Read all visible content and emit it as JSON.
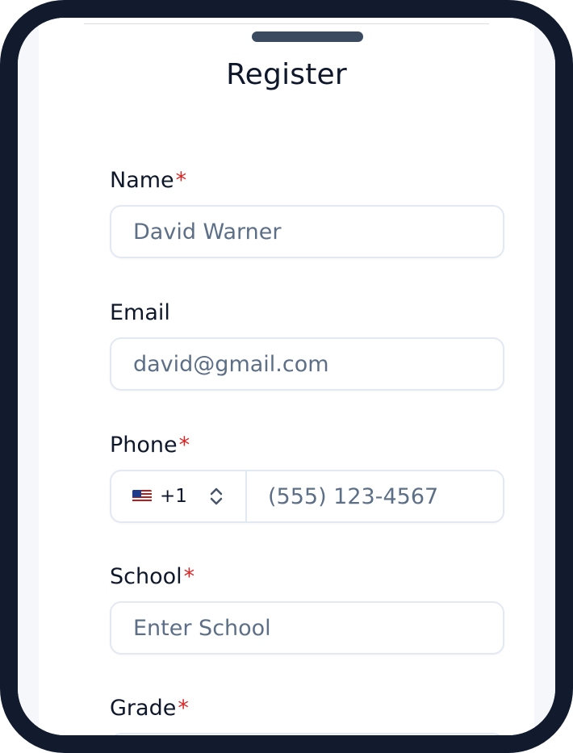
{
  "sheet": {
    "title": "Register"
  },
  "form": {
    "required_mark": "*",
    "name": {
      "label": "Name",
      "value": "David Warner"
    },
    "email": {
      "label": "Email",
      "value": "david@gmail.com"
    },
    "phone": {
      "label": "Phone",
      "country_code": "+1",
      "flag_icon": "us-flag-icon",
      "stepper_icon": "up-down-chevron-icon",
      "placeholder": "(555) 123-4567"
    },
    "school": {
      "label": "School",
      "placeholder": "Enter School"
    },
    "grade": {
      "label": "Grade"
    }
  },
  "colors": {
    "frame": "#111b2d",
    "required": "#dc2626",
    "text": "#0f172a",
    "placeholder": "#5d6f86",
    "input_border": "#e3e9f2"
  }
}
